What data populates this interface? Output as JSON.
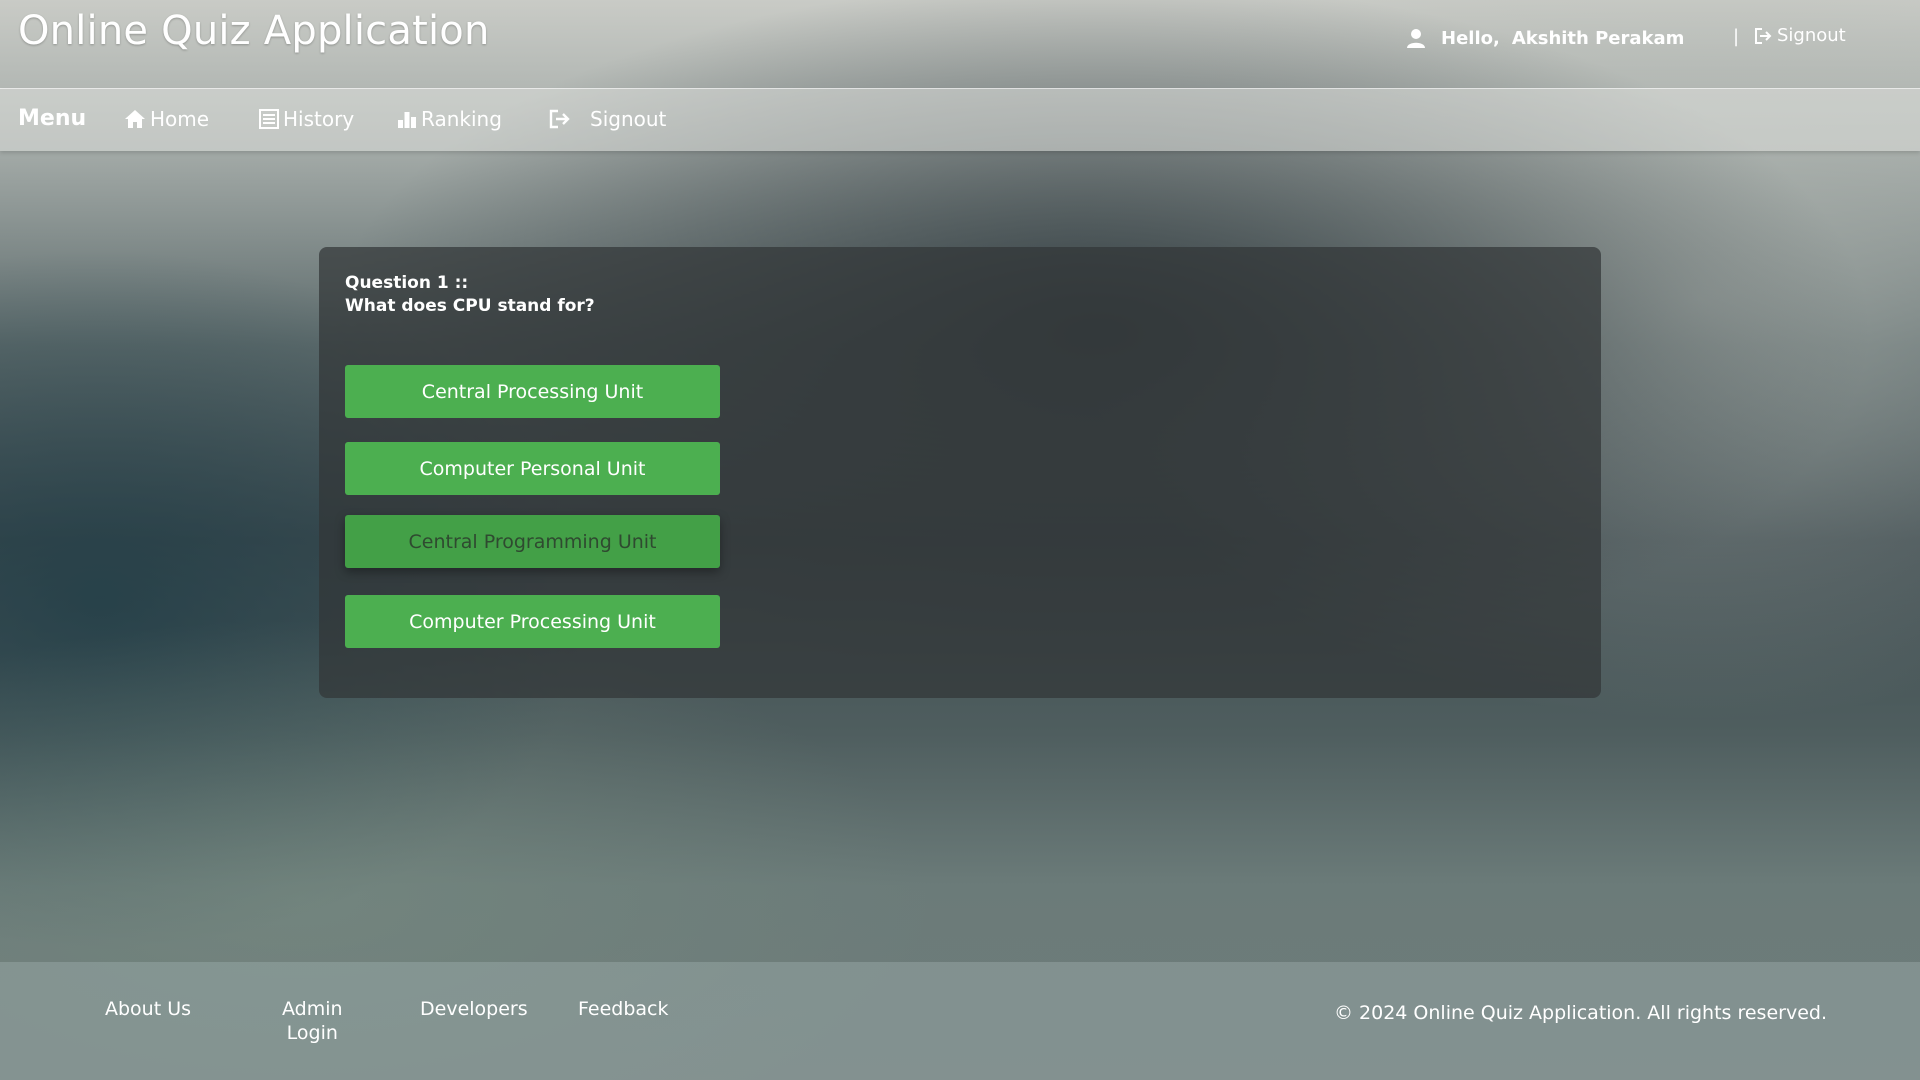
{
  "header": {
    "app_title": "Online Quiz Application",
    "hello": "Hello,",
    "username": "Akshith Perakam",
    "separator": "|",
    "signout": "Signout"
  },
  "nav": {
    "menu": "Menu",
    "home": "Home",
    "history": "History",
    "ranking": "Ranking",
    "signout": "Signout"
  },
  "quiz": {
    "question_label": "Question  1 ::",
    "question_text": "What does CPU stand for?",
    "options": [
      "Central Processing Unit",
      "Computer Personal Unit",
      "Central Programming Unit",
      "Computer Processing Unit"
    ],
    "option_color": "#4caf50"
  },
  "footer": {
    "about": "About Us",
    "admin_line1": "Admin",
    "admin_line2": "Login",
    "developers": "Developers",
    "feedback": "Feedback",
    "copyright": "© 2024 Online Quiz Application. All rights reserved."
  },
  "icons": [
    "user-icon",
    "signout-icon",
    "home-icon",
    "history-icon",
    "ranking-icon"
  ]
}
